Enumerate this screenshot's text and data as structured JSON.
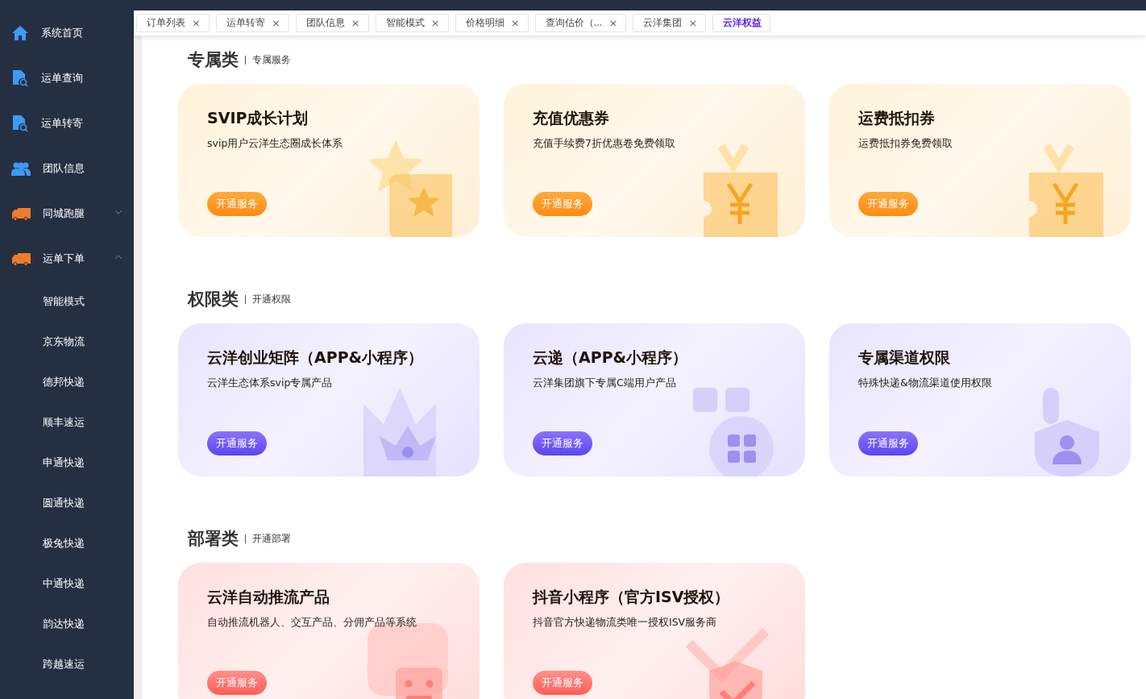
{
  "sidebar": {
    "items": [
      {
        "label": "系统首页"
      },
      {
        "label": "运单查询"
      },
      {
        "label": "运单转寄"
      },
      {
        "label": "团队信息"
      },
      {
        "label": "同城跑腿",
        "expanded": false
      },
      {
        "label": "运单下单",
        "expanded": true,
        "children": [
          {
            "label": "智能模式"
          },
          {
            "label": "京东物流"
          },
          {
            "label": "德邦快递"
          },
          {
            "label": "顺丰速运"
          },
          {
            "label": "申通快递"
          },
          {
            "label": "圆通快递"
          },
          {
            "label": "极兔快递"
          },
          {
            "label": "中通快递"
          },
          {
            "label": "韵达快递"
          },
          {
            "label": "跨越速运"
          }
        ]
      }
    ]
  },
  "tabs": [
    {
      "label": "订单列表",
      "close": "×",
      "selected": false
    },
    {
      "label": "运单转寄",
      "close": "×",
      "selected": false
    },
    {
      "label": "团队信息",
      "close": "×",
      "selected": false
    },
    {
      "label": "智能模式",
      "close": "×",
      "selected": false
    },
    {
      "label": "价格明细",
      "close": "×",
      "selected": false
    },
    {
      "label": "查询估价（...",
      "close": "×",
      "selected": false
    },
    {
      "label": "云洋集团",
      "close": "×",
      "selected": false
    },
    {
      "label": "云洋权益",
      "selected": true
    }
  ],
  "sections": [
    {
      "title": "专属类",
      "subtitle": "专属服务",
      "cards": [
        {
          "title": "SVIP成长计划",
          "desc": "svip用户云洋生态圈成长体系",
          "button": "开通服务",
          "kind": "star"
        },
        {
          "title": "充值优惠券",
          "desc": "充值手续费7折优惠卷免费领取",
          "button": "开通服务",
          "kind": "yen"
        },
        {
          "title": "运费抵扣券",
          "desc": "运费抵扣券免费领取",
          "button": "开通服务",
          "kind": "yen"
        }
      ]
    },
    {
      "title": "权限类",
      "subtitle": "开通权限",
      "cards": [
        {
          "title": "云洋创业矩阵（APP&小程序）",
          "desc": "云洋生态体系svip专属产品",
          "button": "开通服务",
          "kind": "crown"
        },
        {
          "title": "云递（APP&小程序）",
          "desc": "云洋集团旗下专属C端用户产品",
          "button": "开通服务",
          "kind": "grid"
        },
        {
          "title": "专属渠道权限",
          "desc": "特殊快递&物流渠道使用权限",
          "button": "开通服务",
          "kind": "shield-person"
        }
      ]
    },
    {
      "title": "部署类",
      "subtitle": "开通部署",
      "cards": [
        {
          "title": "云洋自动推流产品",
          "desc": "自动推流机器人、交互产品、分佣产品等系统",
          "button": "开通服务",
          "kind": "robot"
        },
        {
          "title": "抖音小程序（官方ISV授权）",
          "desc": "抖音官方快递物流类唯一授权ISV服务商",
          "button": "开通服务",
          "kind": "shield-check"
        }
      ]
    }
  ]
}
